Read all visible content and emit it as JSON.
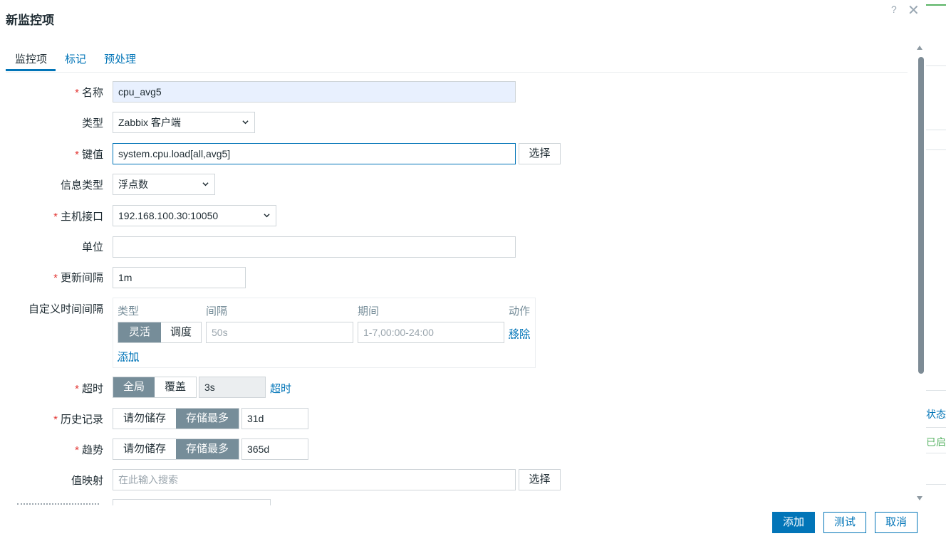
{
  "dialog": {
    "title": "新监控项",
    "help_glyph": "?",
    "close_glyph": "✕"
  },
  "tabs": [
    {
      "label": "监控项"
    },
    {
      "label": "标记"
    },
    {
      "label": "预处理"
    }
  ],
  "form": {
    "required_mark": "*",
    "name": {
      "label": "名称",
      "value": "cpu_avg5"
    },
    "type": {
      "label": "类型",
      "value": "Zabbix 客户端"
    },
    "key": {
      "label": "键值",
      "value": "system.cpu.load[all,avg5]",
      "select_label": "选择"
    },
    "info_type": {
      "label": "信息类型",
      "value": "浮点数"
    },
    "host_interface": {
      "label": "主机接口",
      "value": "192.168.100.30:10050"
    },
    "units": {
      "label": "单位",
      "value": ""
    },
    "update_interval": {
      "label": "更新间隔",
      "value": "1m"
    },
    "custom_intervals": {
      "label": "自定义时间间隔",
      "headers": {
        "type": "类型",
        "interval": "间隔",
        "period": "期间",
        "action": "动作"
      },
      "row": {
        "flexible": "灵活",
        "scheduling": "调度",
        "interval_placeholder": "50s",
        "period_placeholder": "1-7,00:00-24:00",
        "remove": "移除"
      },
      "add": "添加"
    },
    "timeout": {
      "label": "超时",
      "global": "全局",
      "override": "覆盖",
      "value": "3s",
      "link": "超时"
    },
    "history": {
      "label": "历史记录",
      "do_not_store": "请勿储存",
      "store_up_to": "存储最多",
      "value": "31d"
    },
    "trends": {
      "label": "趋势",
      "do_not_store": "请勿储存",
      "store_up_to": "存储最多",
      "value": "365d"
    },
    "value_map": {
      "label": "值映射",
      "placeholder": "在此输入搜索",
      "select_label": "选择"
    }
  },
  "footer": {
    "add": "添加",
    "test": "测试",
    "cancel": "取消"
  },
  "background_page": {
    "status": "状态",
    "enabled": "已启"
  },
  "colors": {
    "accent": "#0275b8",
    "required": "#e33734",
    "toggle_on": "#768d99",
    "autofill": "#e8f0fe"
  },
  "icons": {
    "dropdown": "chevron-down-icon",
    "close": "close-icon",
    "help": "help-icon"
  }
}
